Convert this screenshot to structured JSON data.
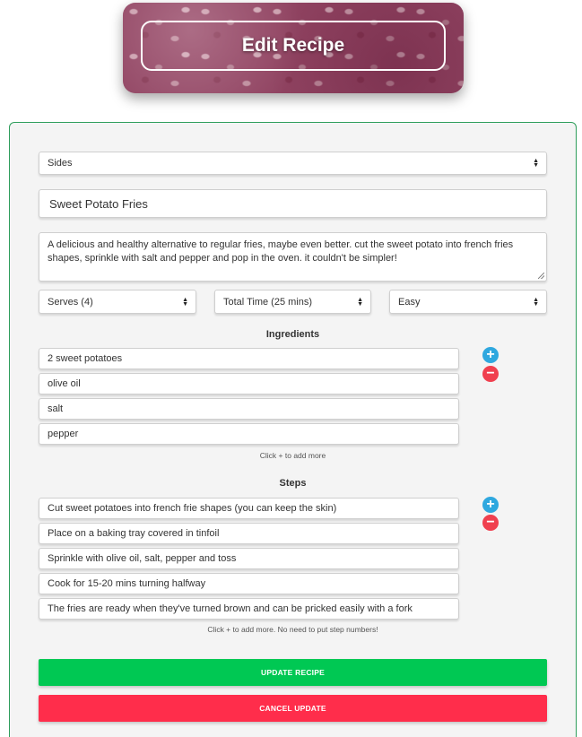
{
  "header": {
    "title": "Edit Recipe"
  },
  "form": {
    "category": "Sides",
    "name": "Sweet Potato Fries",
    "description": "A delicious and healthy alternative to regular fries, maybe even better. cut the sweet potato into french fries shapes, sprinkle with salt and pepper and pop in the oven. it couldn't be simpler!",
    "serves": "Serves (4)",
    "total_time": "Total Time (25 mins)",
    "difficulty": "Easy"
  },
  "ingredients": {
    "title": "Ingredients",
    "items": [
      "2 sweet potatoes",
      "olive oil",
      "salt",
      "pepper"
    ],
    "hint": "Click + to add more"
  },
  "steps": {
    "title": "Steps",
    "items": [
      "Cut sweet potatoes into french frie shapes (you can keep the skin)",
      "Place on a baking tray covered in tinfoil",
      "Sprinkle with olive oil, salt, pepper and toss",
      "Cook for 15-20 mins turning halfway",
      "The fries are ready when they've turned brown and can be pricked easily with a fork"
    ],
    "hint": "Click + to add more. No need to put step numbers!"
  },
  "buttons": {
    "add_symbol": "+",
    "remove_symbol": "−",
    "update_label": "UPDATE RECIPE",
    "cancel_label": "CANCEL UPDATE"
  },
  "colors": {
    "card_border": "#2e9e5b",
    "add_button": "#2fa8df",
    "remove_button": "#f0404f",
    "update_button": "#00c853",
    "cancel_button": "#ff2d4b"
  }
}
